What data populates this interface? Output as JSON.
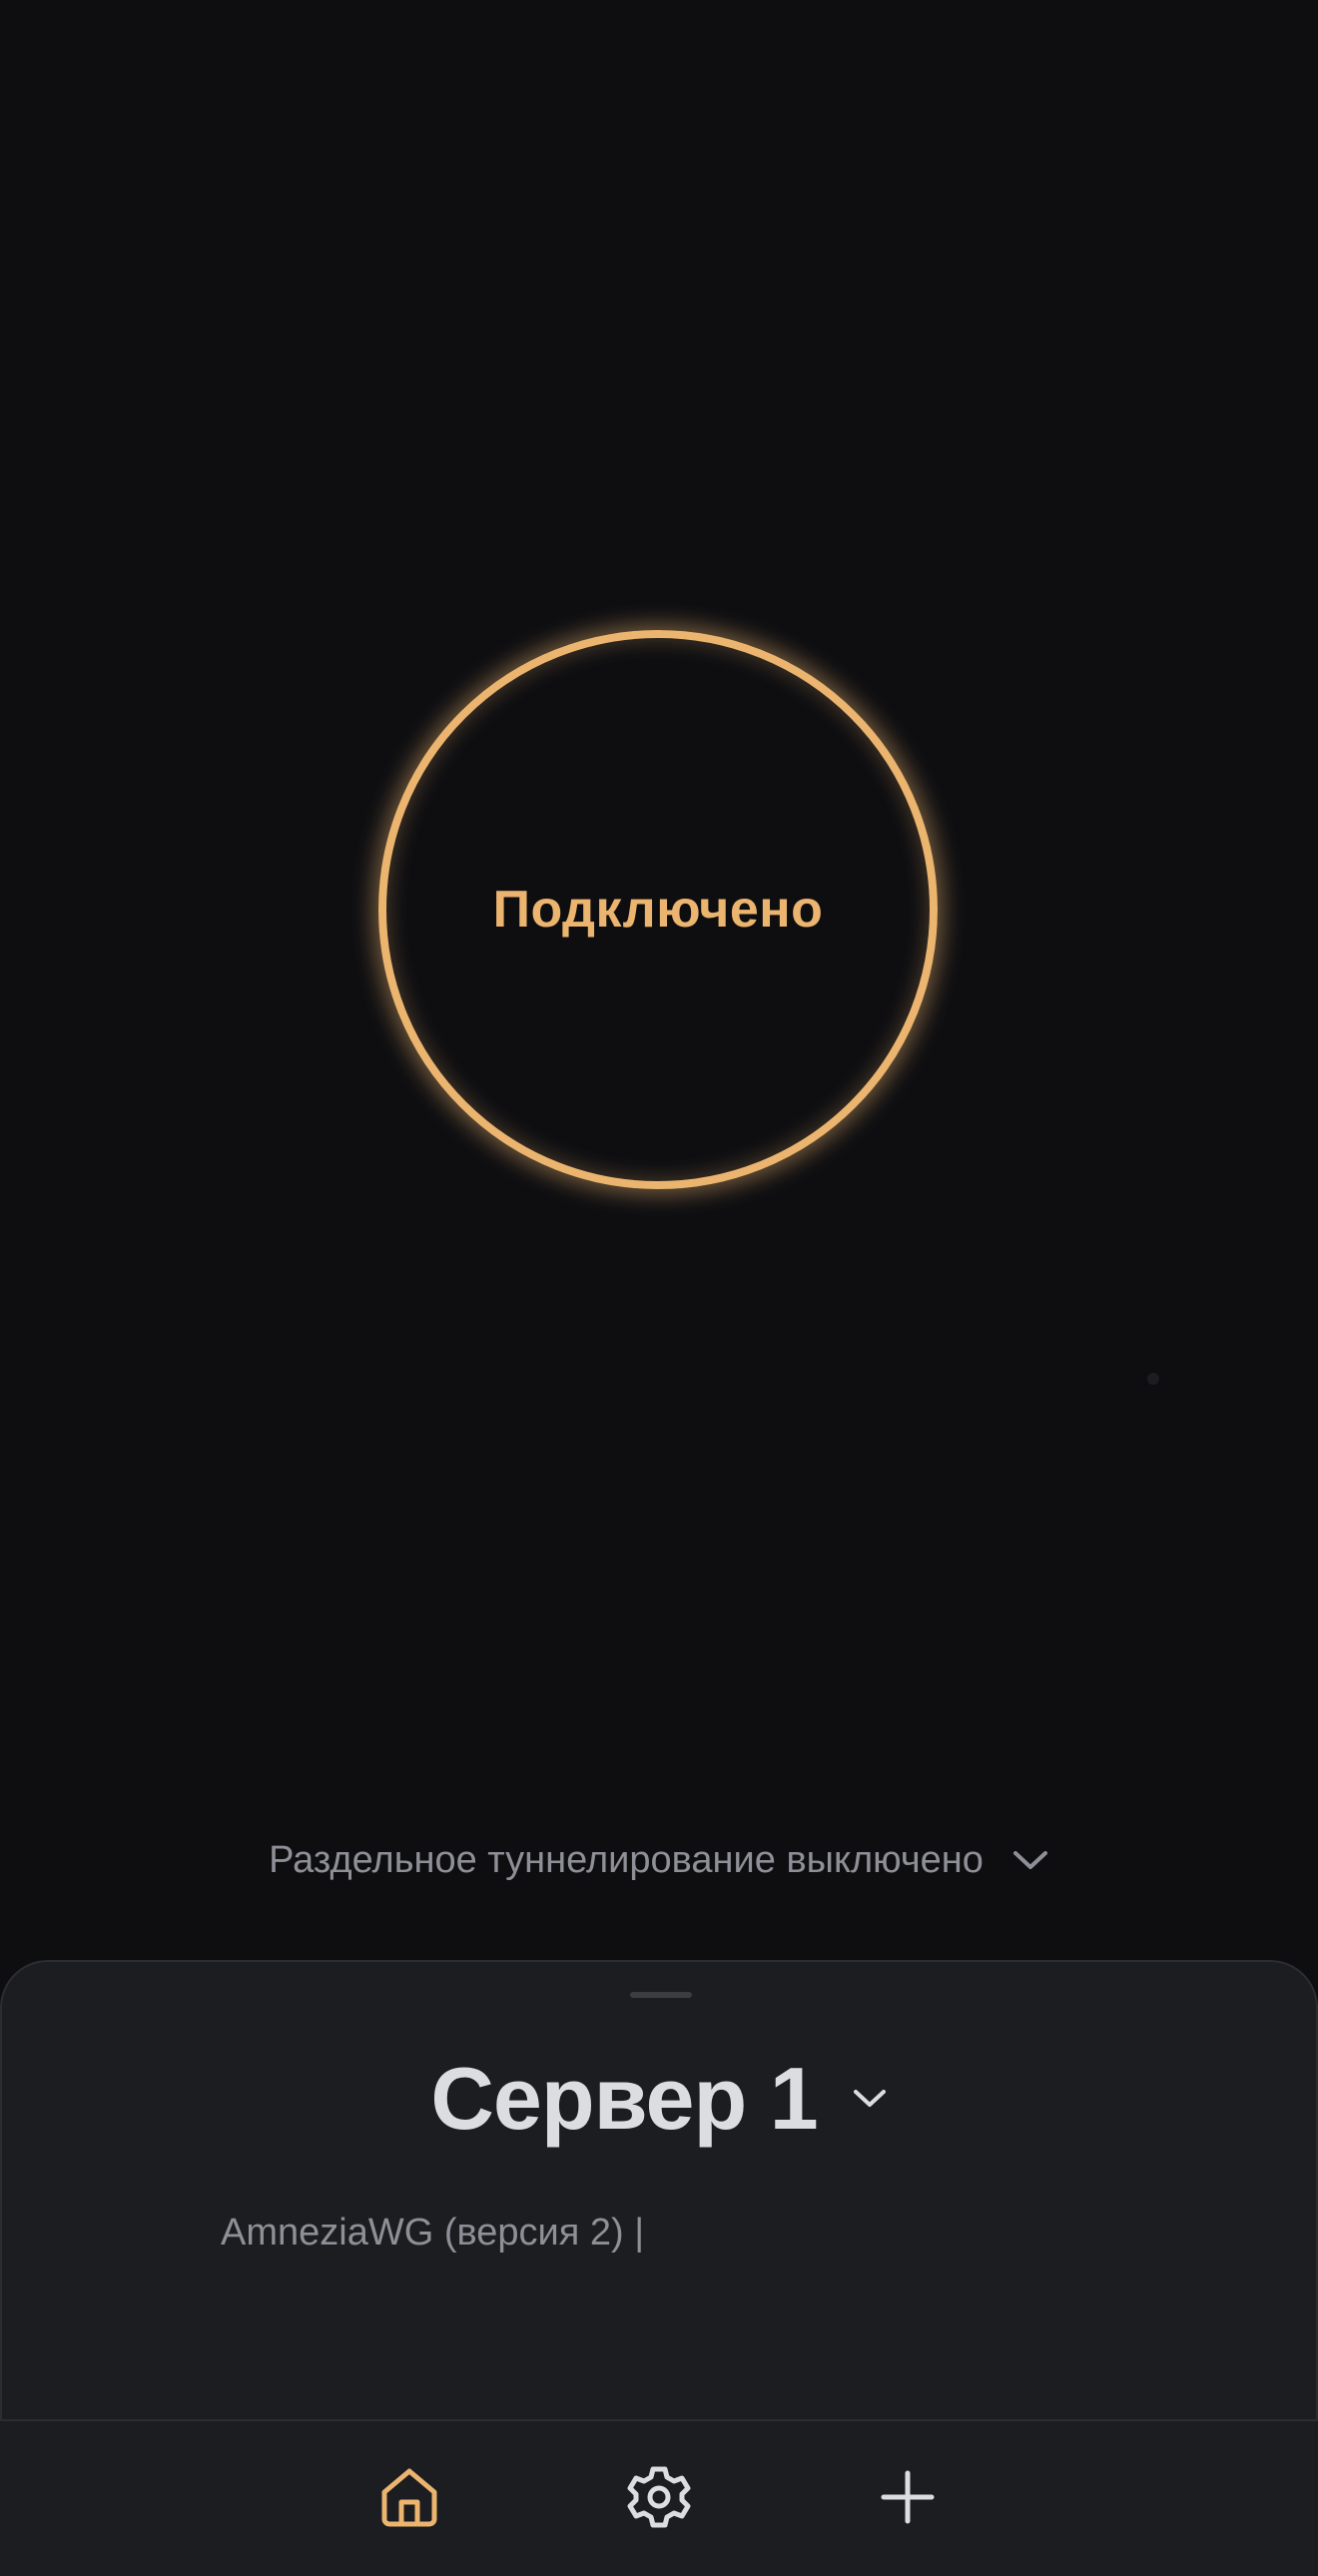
{
  "connection": {
    "status_label": "Подключено",
    "accent_color": "#ebb46f"
  },
  "split_tunneling": {
    "label": "Раздельное туннелирование выключено",
    "icon": "chevron-down-icon"
  },
  "server": {
    "name": "Сервер 1",
    "protocol_info": "AmneziaWG (версия 2) |",
    "icon": "chevron-down-icon"
  },
  "nav": {
    "items": [
      {
        "icon": "home-icon",
        "active": true
      },
      {
        "icon": "gear-icon",
        "active": false
      },
      {
        "icon": "plus-icon",
        "active": false
      }
    ]
  },
  "colors": {
    "background": "#0e0e11",
    "sheet": "#1c1d21",
    "text_primary": "#dcdde1",
    "text_secondary": "#8f9097"
  }
}
